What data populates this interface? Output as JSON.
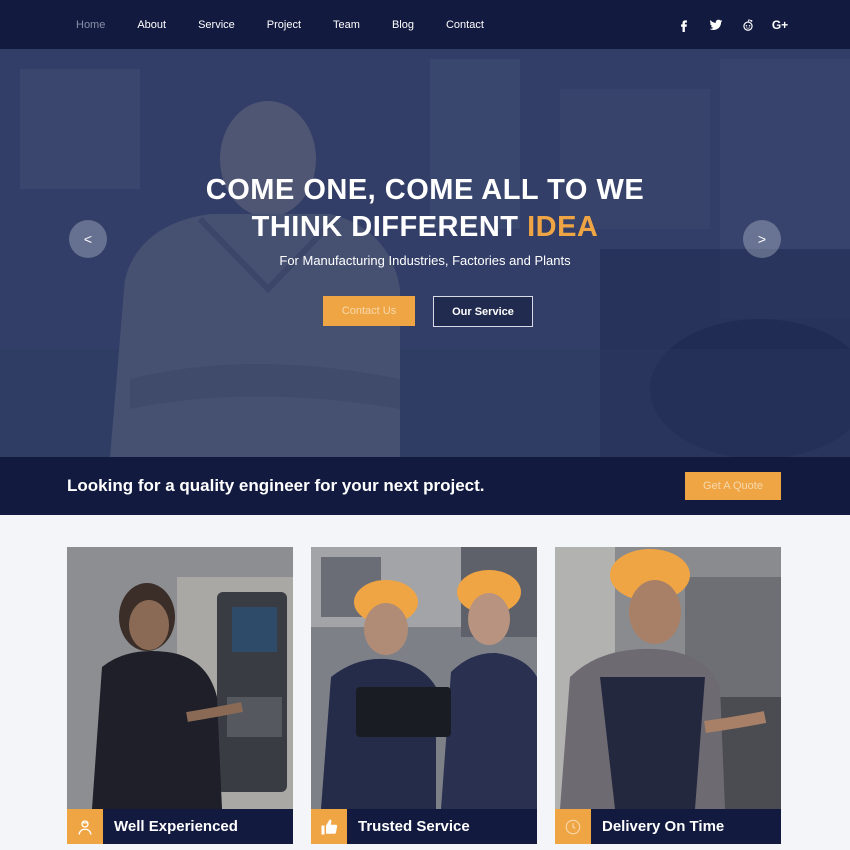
{
  "nav": {
    "items": [
      {
        "label": "Home",
        "active": true
      },
      {
        "label": "About"
      },
      {
        "label": "Service"
      },
      {
        "label": "Project"
      },
      {
        "label": "Team"
      },
      {
        "label": "Blog"
      },
      {
        "label": "Contact"
      }
    ],
    "social": [
      "facebook-icon",
      "twitter-icon",
      "reddit-icon",
      "google-plus-icon"
    ],
    "google_plus_glyph": "G+"
  },
  "hero": {
    "title_line1": "COME ONE, COME ALL TO WE",
    "title_line2_main": "THINK DIFFERENT ",
    "title_line2_accent": "IDEA",
    "subtitle": "For Manufacturing Industries, Factories and Plants",
    "primary_button": "Contact Us",
    "secondary_button": "Our Service",
    "prev_arrow": "<",
    "next_arrow": ">"
  },
  "cta": {
    "text": "Looking for a quality engineer for your next project.",
    "button": "Get A Quote"
  },
  "features": [
    {
      "title": "Well Experienced",
      "icon": "worker-icon"
    },
    {
      "title": "Trusted Service",
      "icon": "thumbs-up-icon"
    },
    {
      "title": "Delivery On Time",
      "icon": "clock-icon"
    }
  ],
  "colors": {
    "navy": "#121a3f",
    "accent": "#f0a544"
  }
}
